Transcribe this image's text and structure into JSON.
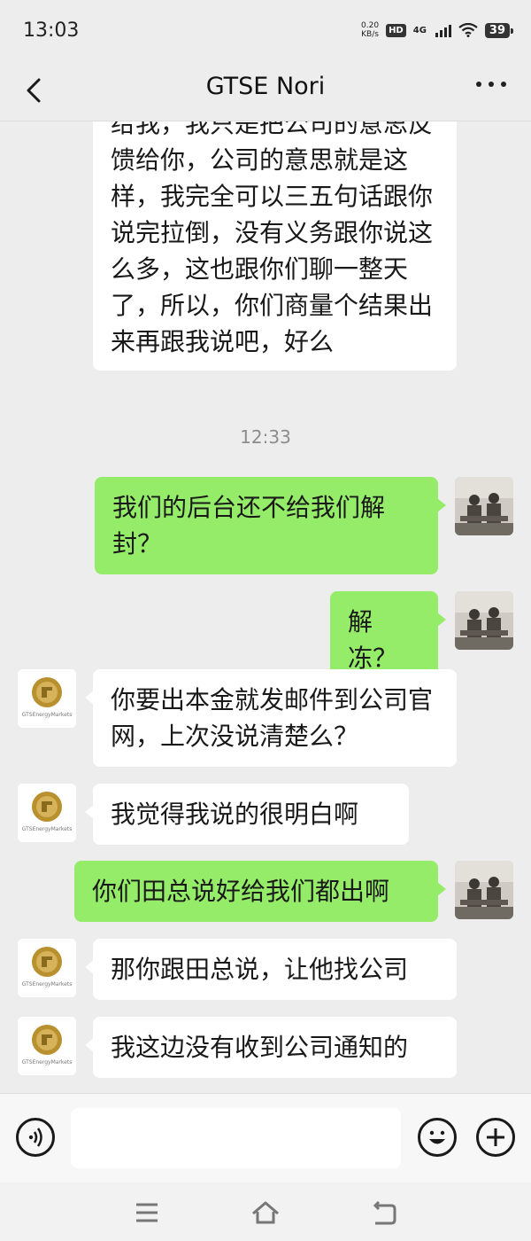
{
  "status_bar": {
    "time": "13:03",
    "net_speed_value": "0.20",
    "net_speed_unit": "KB/s",
    "hd": "HD",
    "network": "4G",
    "battery": "39"
  },
  "header": {
    "title": "GTSE  Nori"
  },
  "messages": [
    {
      "side": "in",
      "avatar": false,
      "text": "给我，我只是把公司的意思反馈给你，公司的意思就是这样，我完全可以三五句话跟你说完拉倒，没有义务跟你说这么多，这也跟你们聊一整天了，所以，你们商量个结果出来再跟我说吧，好么"
    },
    {
      "timestamp": "12:33"
    },
    {
      "side": "out",
      "text": "我们的后台还不给我们解封？"
    },
    {
      "side": "out",
      "text": "解冻？"
    },
    {
      "side": "in",
      "text": "你要出本金就发邮件到公司官网，上次没说清楚么？"
    },
    {
      "side": "in",
      "text": "我觉得我说的很明白啊"
    },
    {
      "side": "out",
      "text": "你们田总说好给我们都出啊"
    },
    {
      "side": "in",
      "text": "那你跟田总说，让他找公司"
    },
    {
      "side": "in",
      "text": "我这边没有收到公司通知的"
    }
  ],
  "contact_avatar": {
    "logo_text": "GTSEnergyMarkets",
    "logo_color": "#b8902e"
  },
  "colors": {
    "incoming_bubble": "#ffffff",
    "outgoing_bubble": "#95ec69",
    "background": "#ededed"
  },
  "icons": {
    "back": "chevron-left-icon",
    "more": "more-dots-icon",
    "voice": "voice-icon",
    "emoji": "emoji-icon",
    "plus": "plus-icon",
    "nav_menu": "menu-icon",
    "nav_home": "home-icon",
    "nav_back": "back-icon"
  }
}
